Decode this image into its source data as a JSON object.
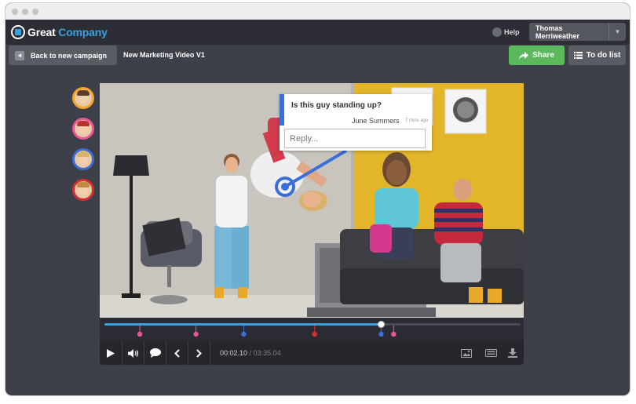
{
  "app": {
    "brand_first": "Great",
    "brand_second": "Company",
    "help_label": "Help",
    "user_name": "Thomas Merriweather"
  },
  "toolbar": {
    "back_label": "Back to new campaign",
    "video_title": "New Marketing Video V1",
    "share_label": "Share",
    "todo_label": "To do list"
  },
  "comment": {
    "question": "Is this guy standing up?",
    "author": "June Summers",
    "time_ago": "7 mins ago",
    "reply_placeholder": "Reply..."
  },
  "player": {
    "current_time": "00:02.10",
    "separator": "/",
    "total_time": "03:35.04",
    "progress": 0.665,
    "markers": [
      {
        "position": 0.085,
        "color": "#e9579a"
      },
      {
        "position": 0.22,
        "color": "#e9579a"
      },
      {
        "position": 0.335,
        "color": "#3b6fd8"
      },
      {
        "position": 0.505,
        "color": "#d23030"
      },
      {
        "position": 0.665,
        "color": "#3b6fd8"
      },
      {
        "position": 0.695,
        "color": "#e9579a"
      }
    ]
  },
  "colors": {
    "accent": "#3aa0e0",
    "share": "#5cb85c",
    "avatar_rings": [
      "#f3a526",
      "#e9579a",
      "#3b6fd8",
      "#d23030"
    ]
  }
}
